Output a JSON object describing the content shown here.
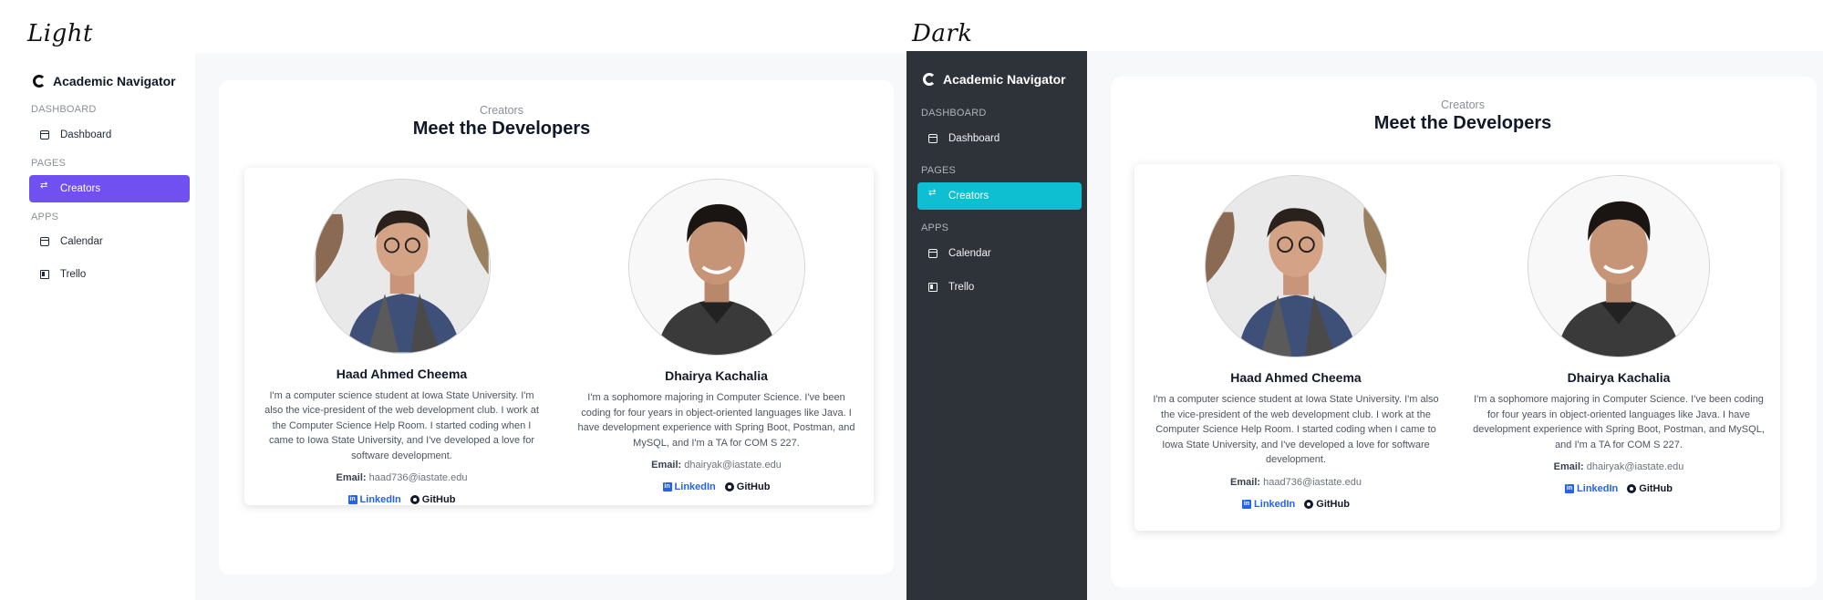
{
  "labels": {
    "light": "Light",
    "dark": "Dark"
  },
  "app": {
    "name": "Academic Navigator"
  },
  "sidebar": {
    "sections": [
      {
        "title": "DASHBOARD",
        "items": [
          {
            "label": "Dashboard",
            "icon": "calendar-check-icon"
          }
        ]
      },
      {
        "title": "PAGES",
        "items": [
          {
            "label": "Creators",
            "icon": "users-icon",
            "active": true
          }
        ]
      },
      {
        "title": "APPS",
        "items": [
          {
            "label": "Calendar",
            "icon": "calendar-icon"
          },
          {
            "label": "Trello",
            "icon": "trello-icon"
          }
        ]
      }
    ]
  },
  "page": {
    "eyebrow": "Creators",
    "title": "Meet the Developers"
  },
  "developers": [
    {
      "name": "Haad Ahmed Cheema",
      "bio": "I'm a computer science student at Iowa State University. I'm also the vice-president of the web development club. I work at the Computer Science Help Room. I started coding when I came to Iowa State University, and I've developed a love for software development.",
      "email_label": "Email:",
      "email": "haad736@iastate.edu",
      "linkedin": "LinkedIn",
      "github": "GitHub"
    },
    {
      "name": "Dhairya Kachalia",
      "bio": "I'm a sophomore majoring in Computer Science. I've been coding for four years in object-oriented languages like Java. I have development experience with Spring Boot, Postman, and MySQL, and I'm a TA for COM S 227.",
      "email_label": "Email:",
      "email": "dhairyak@iastate.edu",
      "linkedin": "LinkedIn",
      "github": "GitHub"
    }
  ],
  "colors": {
    "light_accent": "#7050f0",
    "dark_accent": "#0dbfd0",
    "dark_sidebar": "#2e3239",
    "link": "#2563eb"
  }
}
